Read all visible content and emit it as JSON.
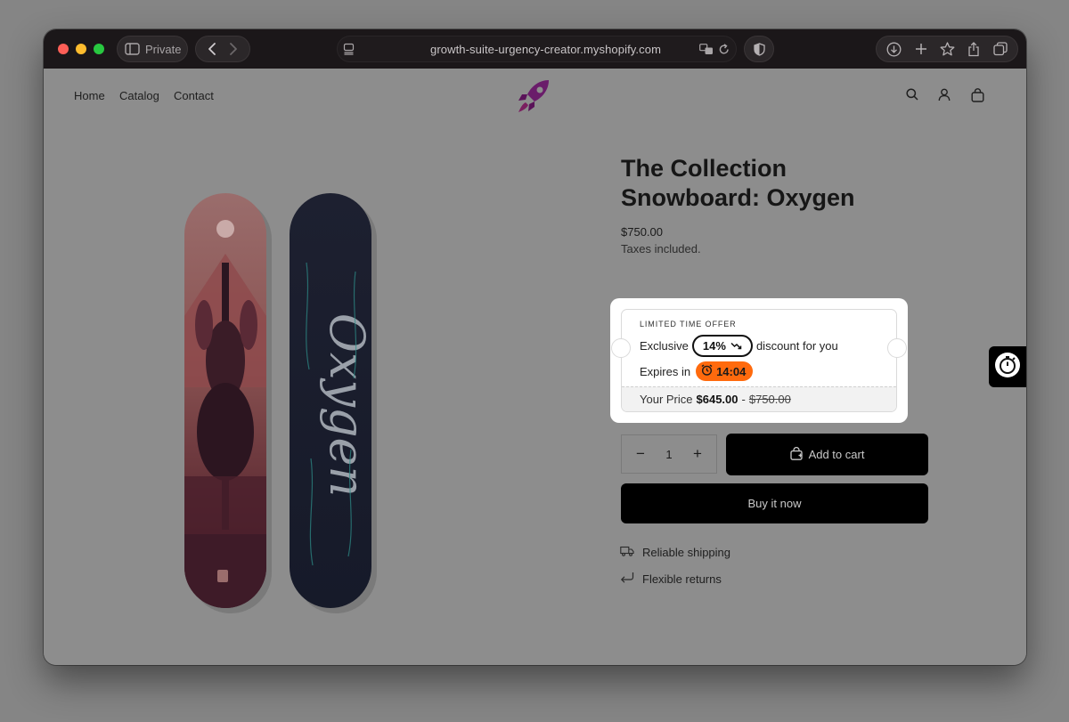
{
  "browser": {
    "private_label": "Private",
    "url": "growth-suite-urgency-creator.myshopify.com"
  },
  "nav": {
    "items": [
      "Home",
      "Catalog",
      "Contact"
    ]
  },
  "product": {
    "title": "The Collection Snowboard: Oxygen",
    "price": "$750.00",
    "taxes_note": "Taxes included.",
    "board_text": "Oxygen"
  },
  "offer": {
    "heading": "LIMITED TIME OFFER",
    "line1_prefix": "Exclusive",
    "discount": "14%",
    "line1_suffix": "discount for you",
    "expires_label": "Expires in",
    "timer": "14:04",
    "your_price_label": "Your Price",
    "new_price": "$645.00",
    "separator": "-",
    "old_price": "$750.00",
    "colors": {
      "timer_bg": "#ff6a0d",
      "badge_border": "#111111"
    }
  },
  "purchase": {
    "quantity": "1",
    "minus": "−",
    "plus": "+",
    "add_to_cart": "Add to cart",
    "buy_now": "Buy it now"
  },
  "features": [
    "Reliable shipping",
    "Flexible returns"
  ],
  "icons": {
    "logo": "rocket-logo-icon",
    "header": [
      "search-icon",
      "account-icon",
      "cart-icon"
    ],
    "features": [
      "truck-icon",
      "return-arrow-icon"
    ],
    "side_tab": "stopwatch-icon"
  }
}
